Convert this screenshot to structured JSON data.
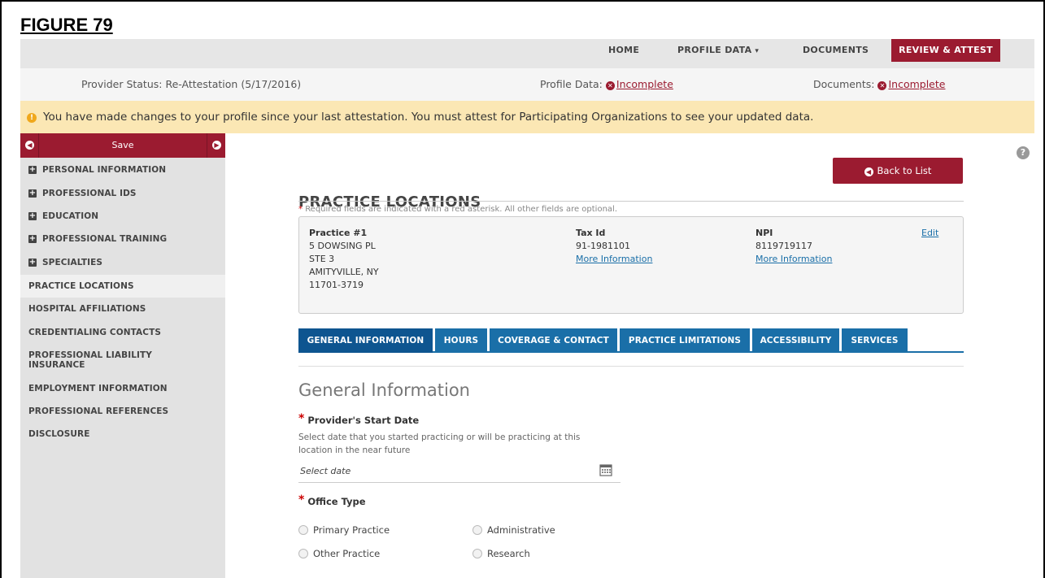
{
  "figure_label": "FIGURE 79",
  "nav": {
    "home": "HOME",
    "profile_data": "PROFILE DATA",
    "documents": "DOCUMENTS",
    "review_attest": "REVIEW & ATTEST"
  },
  "status": {
    "provider_status": "Provider Status: Re-Attestation (5/17/2016)",
    "profile_label": "Profile Data:",
    "profile_value": "Incomplete",
    "documents_label": "Documents:",
    "documents_value": "Incomplete"
  },
  "alert_text": "You have made changes to your profile since your last attestation. You must attest for Participating Organizations to see your updated data.",
  "sidebar": {
    "save_label": "Save",
    "items": [
      {
        "label": "PERSONAL INFORMATION",
        "icon": "plus-icon"
      },
      {
        "label": "PROFESSIONAL IDS",
        "icon": "plus-icon"
      },
      {
        "label": "EDUCATION",
        "icon": "plus-icon"
      },
      {
        "label": "PROFESSIONAL TRAINING",
        "icon": "plus-icon"
      },
      {
        "label": "SPECIALTIES",
        "icon": "plus-icon"
      },
      {
        "label": "PRACTICE LOCATIONS"
      },
      {
        "label": "HOSPITAL AFFILIATIONS"
      },
      {
        "label": "CREDENTIALING CONTACTS"
      },
      {
        "label": "PROFESSIONAL LIABILITY INSURANCE"
      },
      {
        "label": "EMPLOYMENT INFORMATION"
      },
      {
        "label": "PROFESSIONAL REFERENCES"
      },
      {
        "label": "DISCLOSURE"
      }
    ]
  },
  "main": {
    "title": "PRACTICE LOCATIONS",
    "back_label": "Back to List",
    "required_note": "Required fields are indicated with a red asterisk. All other fields are optional.",
    "practice": {
      "name": "Practice #1",
      "address1": "5 DOWSING PL",
      "address2": "STE 3",
      "city": "AMITYVILLE, NY",
      "zip": "11701-3719",
      "tax_label": "Tax Id",
      "tax_value": "91-1981101",
      "tax_more": "More Information",
      "npi_label": "NPI",
      "npi_value": "8119719117",
      "npi_more": "More Information",
      "edit": "Edit"
    },
    "tabs": [
      "GENERAL INFORMATION",
      "HOURS",
      "COVERAGE & CONTACT",
      "PRACTICE LIMITATIONS",
      "ACCESSIBILITY",
      "SERVICES"
    ],
    "section_title": "General Information",
    "start_date_label": "Provider's Start Date",
    "start_date_help": "Select date that you started practicing or will be practicing at this location in the near future",
    "start_date_placeholder": "Select date",
    "office_type_label": "Office Type",
    "office_types": [
      "Primary Practice",
      "Administrative",
      "Other Practice",
      "Research"
    ]
  },
  "colors": {
    "brand": "#9b1b30",
    "tab_blue": "#1a6fa8",
    "alert_bg": "#fbe7b4"
  }
}
